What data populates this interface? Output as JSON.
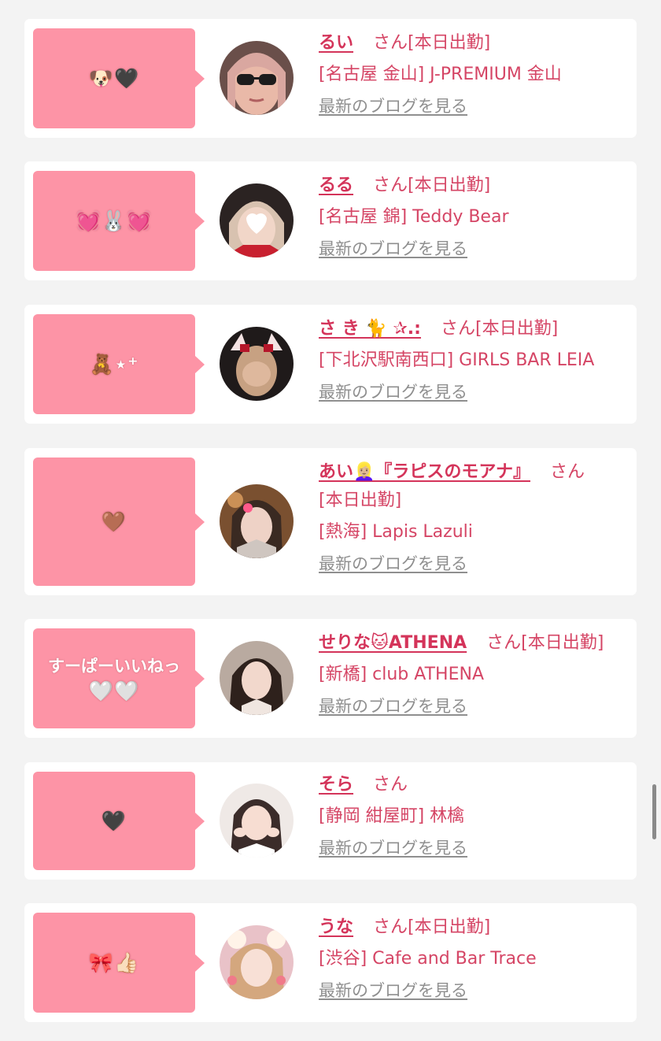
{
  "blog_link_label": "最新のブログを見る",
  "san_label": "さん",
  "cards": [
    {
      "bubble_text": "",
      "bubble_emoji": "🐶🖤",
      "name": "るい",
      "attendance": "[本日出勤]",
      "shop": "[名古屋 金山] J-PREMIUM 金山",
      "avatar_icon": "profile-photo-icon"
    },
    {
      "bubble_text": "",
      "bubble_emoji": "💓🐰💓",
      "name": "るる",
      "attendance": "[本日出勤]",
      "shop": "[名古屋 錦] Teddy Bear",
      "avatar_icon": "profile-photo-icon"
    },
    {
      "bubble_text": "",
      "bubble_emoji": "🧸⋆⁺",
      "name": "さ き 🐈 ✰.:",
      "attendance": "[本日出勤]",
      "shop": "[下北沢駅南西口] GIRLS BAR LEIA",
      "avatar_icon": "profile-photo-icon"
    },
    {
      "bubble_text": "",
      "bubble_emoji": "🤎",
      "name": "あい👱🏼‍♀️『ラピスのモアナ』",
      "attendance": "[本日出勤]",
      "shop": "[熱海] Lapis Lazuli",
      "avatar_icon": "profile-photo-icon"
    },
    {
      "bubble_text": "すーぱーいいねっ",
      "bubble_emoji": "🤍🤍",
      "name": "せりな🐱ATHENA",
      "attendance": "[本日出勤]",
      "shop": "[新橋] club ATHENA",
      "avatar_icon": "profile-photo-icon"
    },
    {
      "bubble_text": "",
      "bubble_emoji": "🖤",
      "name": "そら",
      "attendance": "",
      "shop": "[静岡 紺屋町] 林檎",
      "avatar_icon": "profile-photo-icon"
    },
    {
      "bubble_text": "",
      "bubble_emoji": "🎀👍🏻",
      "name": "うな",
      "attendance": "[本日出勤]",
      "shop": "[渋谷] Cafe and Bar Trace",
      "avatar_icon": "profile-photo-icon"
    }
  ],
  "colors": {
    "bubble": "#fd94a6",
    "name": "#d4345a",
    "text": "#d54565",
    "blog_link": "#8f8f8f",
    "background": "#f3f3f3"
  }
}
